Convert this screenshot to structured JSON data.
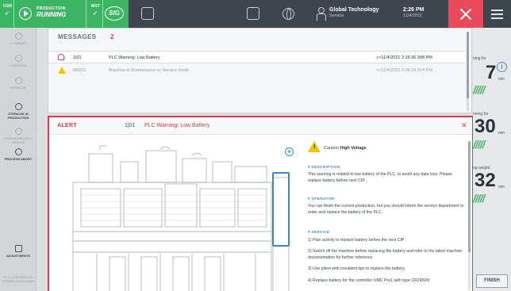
{
  "topbar": {
    "user_label": "USR",
    "production_small": "PRODUCTION",
    "production_state": "RUNNING",
    "mst_label": "MST",
    "logo": "SIG",
    "company": "Global Technology",
    "role": "Service",
    "time": "2:26 PM",
    "date": "11/4/2021",
    "accent_green": "#3cb563",
    "accent_red": "#e84a5a"
  },
  "sidebar": {
    "items": [
      {
        "label": "CLEANING",
        "icon": "cleaning-icon"
      },
      {
        "label": "CHANGING",
        "icon": "changing-icon"
      },
      {
        "label": "STERILIZE",
        "icon": "sterilize-icon"
      },
      {
        "label": "STERILIZE IN PRODUCTION",
        "icon": "sterilize-production-icon"
      },
      {
        "label": "STERILE PRODUCT CHANGE",
        "icon": "product-change-icon"
      },
      {
        "label": "PROCESS ABORT",
        "icon": "abort-icon"
      },
      {
        "label": "ADJUSTMENTS",
        "icon": "sliders-icon"
      },
      {
        "label": "PLC CONTROLLED POWER SHUTDOWN",
        "icon": "power-icon"
      }
    ]
  },
  "messages": {
    "title": "MESSAGES",
    "count": "2",
    "rows": [
      {
        "code": "1|01",
        "text": "PLC Warning: Low Battery",
        "timestamp": ">>11/4/2021 2:26:36.998 PM",
        "icon": "bell-icon"
      },
      {
        "code": "860|01",
        "text": "Machine in Maintenance or Service mode",
        "timestamp": ">>11/4/2021 2:26:34.974 PM",
        "icon": "warning-icon"
      }
    ]
  },
  "alert": {
    "title": "ALERT",
    "code": "1|01",
    "text": "PLC Warning: Low Battery",
    "caution_prefix": "Caution",
    "caution_bold": "High Voltage",
    "description_h": "DESCRIPTION",
    "description": "This warning is related to low battery of the PLC, to avoid any data loss. Please replace battery before next CIP.",
    "operator_h": "OPERATOR",
    "operator": "You can finish the current production, but you should inform the service department to order and replace the battery of the PLC.",
    "service_h": "SERVICE",
    "service_1": "1) Plan activity to replace battery before the next CIP",
    "service_2": "2) Switch off the machine before replacing the battery and refer to the latest machine documentation for further reference.",
    "service_3": "3) Use pliers with insulated tips to replace the battery.",
    "service_4": "4) Replace battery for the controller UMC Pro1 with type CR2450N"
  },
  "rightpanel": {
    "label1": "ning for",
    "value1": "7",
    "unit1": "min",
    "label2": "nning for",
    "value2": "30",
    "unit2": "min",
    "label3": "ng weight",
    "value3": "32",
    "unit3": "min",
    "stripes": "/////",
    "finish": "FINISH"
  }
}
